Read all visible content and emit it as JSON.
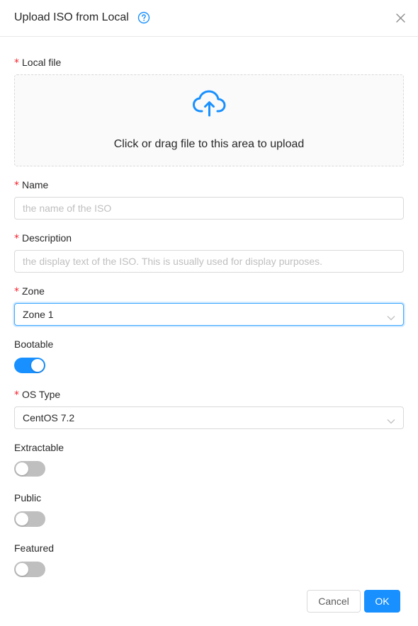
{
  "dialog": {
    "title": "Upload ISO from Local",
    "help_icon": "question-circle-icon",
    "close_icon": "close-icon"
  },
  "form": {
    "local_file": {
      "label": "Local file",
      "required": true,
      "dropzone_icon": "cloud-upload-icon",
      "dropzone_text": "Click or drag file to this area to upload"
    },
    "name": {
      "label": "Name",
      "required": true,
      "value": "",
      "placeholder": "the name of the ISO"
    },
    "description": {
      "label": "Description",
      "required": true,
      "value": "",
      "placeholder": "the display text of the ISO. This is usually used for display purposes."
    },
    "zone": {
      "label": "Zone",
      "required": true,
      "selected": "Zone 1"
    },
    "bootable": {
      "label": "Bootable",
      "checked": true
    },
    "os_type": {
      "label": "OS Type",
      "required": true,
      "selected": "CentOS 7.2"
    },
    "extractable": {
      "label": "Extractable",
      "checked": false
    },
    "public": {
      "label": "Public",
      "checked": false
    },
    "featured": {
      "label": "Featured",
      "checked": false
    }
  },
  "footer": {
    "cancel_label": "Cancel",
    "ok_label": "OK"
  },
  "colors": {
    "primary": "#1890ff",
    "required_mark": "#f5222d",
    "switch_off": "#bfbfbf",
    "border": "#d9d9d9"
  }
}
